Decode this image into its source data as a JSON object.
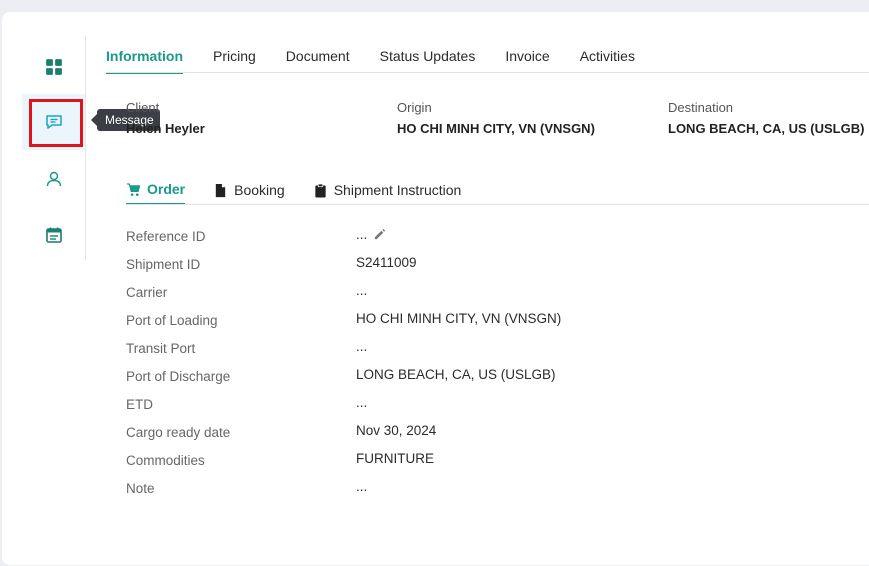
{
  "sidebar": {
    "items": [
      {
        "name": "dashboard",
        "icon": "grid-icon"
      },
      {
        "name": "message",
        "icon": "chat-icon"
      },
      {
        "name": "contacts",
        "icon": "user-icon"
      },
      {
        "name": "schedule",
        "icon": "calendar-icon"
      }
    ],
    "tooltip": "Message"
  },
  "tabs": [
    "Information",
    "Pricing",
    "Document",
    "Status Updates",
    "Invoice",
    "Activities"
  ],
  "summary": {
    "client_label": "Client",
    "client_value": "Helen Heyler",
    "origin_label": "Origin",
    "origin_value": "HO CHI MINH CITY, VN (VNSGN)",
    "destination_label": "Destination",
    "destination_value": "LONG BEACH, CA, US (USLGB)"
  },
  "subtabs": [
    {
      "label": "Order",
      "icon": "cart-icon"
    },
    {
      "label": "Booking",
      "icon": "file-icon"
    },
    {
      "label": "Shipment Instruction",
      "icon": "clipboard-icon"
    }
  ],
  "details": [
    {
      "key": "Reference ID",
      "value": "..."
    },
    {
      "key": "Shipment ID",
      "value": "S2411009"
    },
    {
      "key": "Carrier",
      "value": "..."
    },
    {
      "key": "Port of Loading",
      "value": "HO CHI MINH CITY, VN (VNSGN)"
    },
    {
      "key": "Transit Port",
      "value": "..."
    },
    {
      "key": "Port of Discharge",
      "value": "LONG BEACH, CA, US (USLGB)"
    },
    {
      "key": "ETD",
      "value": "..."
    },
    {
      "key": "Cargo ready date",
      "value": "Nov 30, 2024"
    },
    {
      "key": "Commodities",
      "value": "FURNITURE"
    },
    {
      "key": "Note",
      "value": "..."
    }
  ],
  "colors": {
    "accent": "#1a9a8a",
    "highlight": "#e0141b",
    "active_bg": "#eaf6fb"
  }
}
